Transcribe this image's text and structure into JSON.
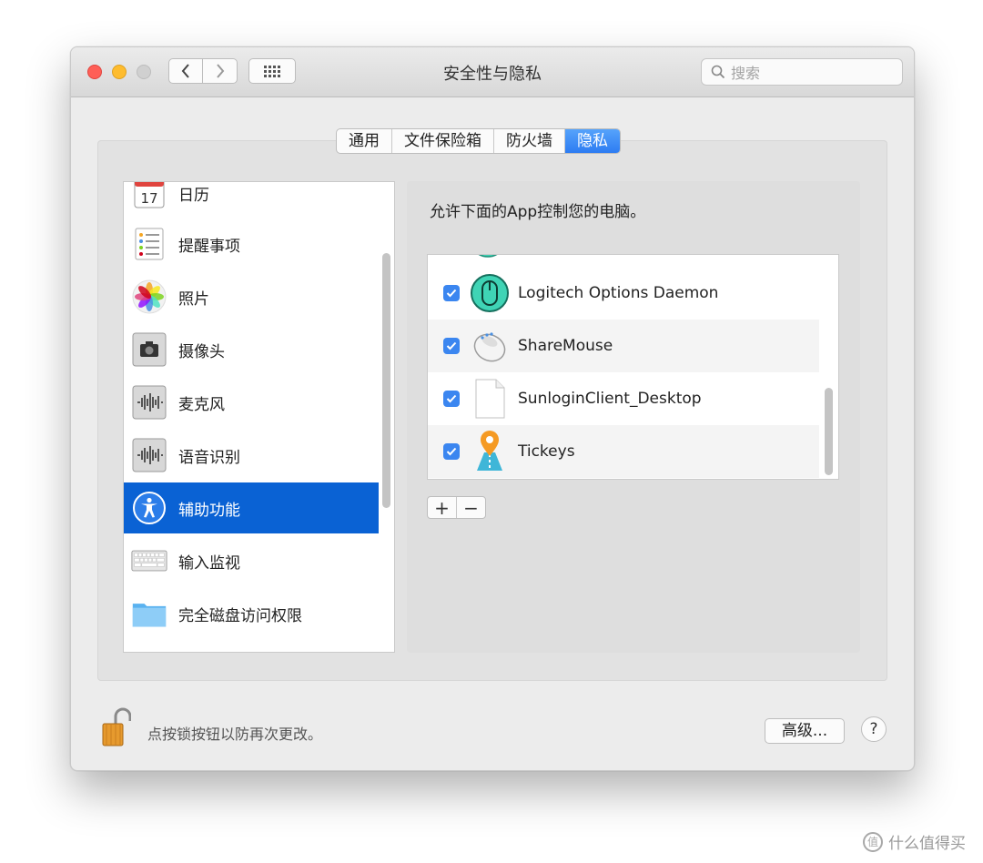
{
  "window": {
    "title": "安全性与隐私",
    "search_placeholder": "搜索"
  },
  "tabs": [
    {
      "label": "通用",
      "active": false
    },
    {
      "label": "文件保险箱",
      "active": false
    },
    {
      "label": "防火墙",
      "active": false
    },
    {
      "label": "隐私",
      "active": true
    }
  ],
  "sidebar": {
    "items": [
      {
        "label": "日历",
        "icon": "calendar-icon",
        "icon_text": "17"
      },
      {
        "label": "提醒事项",
        "icon": "reminders-icon"
      },
      {
        "label": "照片",
        "icon": "photos-icon"
      },
      {
        "label": "摄像头",
        "icon": "camera-icon"
      },
      {
        "label": "麦克风",
        "icon": "microphone-icon"
      },
      {
        "label": "语音识别",
        "icon": "speech-recognition-icon"
      },
      {
        "label": "辅助功能",
        "icon": "accessibility-icon",
        "selected": true
      },
      {
        "label": "输入监视",
        "icon": "keyboard-icon"
      },
      {
        "label": "完全磁盘访问权限",
        "icon": "folder-icon"
      }
    ]
  },
  "main": {
    "allow_text": "允许下面的App控制您的电脑。",
    "apps": [
      {
        "name": "Logitech Options Daemon",
        "checked": true,
        "icon": "logitech-icon"
      },
      {
        "name": "ShareMouse",
        "checked": true,
        "icon": "mouse-icon"
      },
      {
        "name": "SunloginClient_Desktop",
        "checked": true,
        "icon": "document-icon"
      },
      {
        "name": "Tickeys",
        "checked": true,
        "icon": "tickeys-icon"
      }
    ],
    "add_label": "+",
    "remove_label": "−"
  },
  "footer": {
    "lock_text": "点按锁按钮以防再次更改。",
    "advanced_label": "高级...",
    "help_label": "?"
  },
  "watermark": {
    "text": "什么值得买",
    "icon_text": "值"
  },
  "colors": {
    "accent": "#0a62d4",
    "checkbox": "#3b86f0",
    "close": "#ff5f57",
    "minimize": "#febc2e"
  }
}
